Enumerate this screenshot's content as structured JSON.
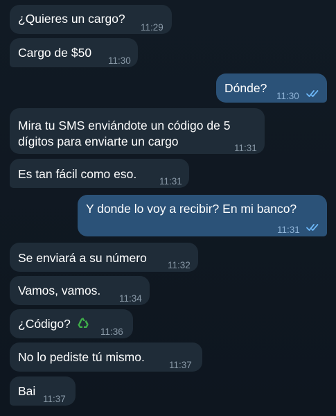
{
  "messages": [
    {
      "direction": "in",
      "text": "¿Quieres un cargo?",
      "time": "11:29"
    },
    {
      "direction": "in",
      "text": "Cargo de $50",
      "time": "11:30"
    },
    {
      "direction": "out",
      "text": "Dónde?",
      "time": "11:30",
      "status": "read-double-check-icon"
    },
    {
      "direction": "in",
      "text_lines": [
        "Mira tu SMS enviándote un código de 5",
        "dígitos para enviarte un cargo"
      ],
      "time": "11:31"
    },
    {
      "direction": "in",
      "text": "Es tan fácil como eso.",
      "time": "11:31"
    },
    {
      "direction": "out",
      "text": "Y donde lo voy a recibir? En mi banco?",
      "time": "11:31",
      "status": "read-double-check-icon"
    },
    {
      "direction": "in",
      "text": "Se enviará a su número",
      "time": "11:32"
    },
    {
      "direction": "in",
      "text": "Vamos, vamos.",
      "time": "11:34"
    },
    {
      "direction": "in",
      "text": "¿Código?",
      "emoji": "recycling-symbol-emoji",
      "time": "11:36"
    },
    {
      "direction": "in",
      "text": "No lo pediste tú mismo.",
      "time": "11:37"
    },
    {
      "direction": "in",
      "text": "Bai",
      "time": "11:37"
    }
  ],
  "colors": {
    "background": "#0f1720",
    "incoming_bubble": "#1f2c38",
    "outgoing_bubble": "#2b5278",
    "text": "#ffffff",
    "time_incoming": "#8a9aa8",
    "time_outgoing": "#8fb3d6",
    "read_ticks": "#6cb6f5",
    "emoji": "#3fae49"
  }
}
